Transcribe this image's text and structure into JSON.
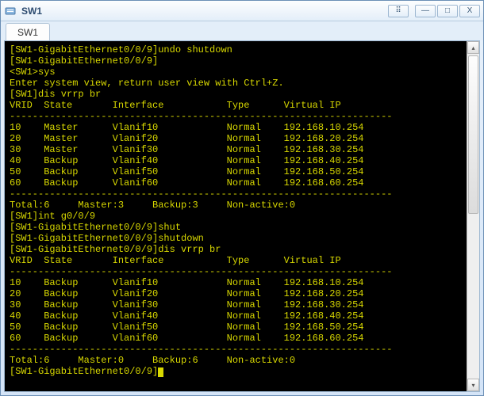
{
  "window": {
    "title": "SW1",
    "tab": "SW1",
    "controls": {
      "pop": "⠿",
      "min": "—",
      "max": "□",
      "close": "X"
    }
  },
  "colors": {
    "term_bg": "#000000",
    "term_fg": "#d8d800"
  },
  "terminal": {
    "lines_pre": [
      "[SW1-GigabitEthernet0/0/9]undo shutdown",
      "[SW1-GigabitEthernet0/0/9]",
      "<SW1>sys",
      "Enter system view, return user view with Ctrl+Z.",
      "[SW1]dis vrrp br"
    ],
    "table1_header": {
      "vrid": "VRID",
      "state": "State",
      "iface": "Interface",
      "type": "Type",
      "vip": "Virtual IP"
    },
    "divider": "-------------------------------------------------------------------",
    "table1": [
      {
        "vrid": "10",
        "state": "Master",
        "iface": "Vlanif10",
        "type": "Normal",
        "vip": "192.168.10.254"
      },
      {
        "vrid": "20",
        "state": "Master",
        "iface": "Vlanif20",
        "type": "Normal",
        "vip": "192.168.20.254"
      },
      {
        "vrid": "30",
        "state": "Master",
        "iface": "Vlanif30",
        "type": "Normal",
        "vip": "192.168.30.254"
      },
      {
        "vrid": "40",
        "state": "Backup",
        "iface": "Vlanif40",
        "type": "Normal",
        "vip": "192.168.40.254"
      },
      {
        "vrid": "50",
        "state": "Backup",
        "iface": "Vlanif50",
        "type": "Normal",
        "vip": "192.168.50.254"
      },
      {
        "vrid": "60",
        "state": "Backup",
        "iface": "Vlanif60",
        "type": "Normal",
        "vip": "192.168.60.254"
      }
    ],
    "summary1": "Total:6     Master:3     Backup:3     Non-active:0",
    "lines_mid": [
      "[SW1]int g0/0/9",
      "[SW1-GigabitEthernet0/0/9]shut",
      "[SW1-GigabitEthernet0/0/9]shutdown",
      "[SW1-GigabitEthernet0/0/9]dis vrrp br"
    ],
    "table2": [
      {
        "vrid": "10",
        "state": "Backup",
        "iface": "Vlanif10",
        "type": "Normal",
        "vip": "192.168.10.254"
      },
      {
        "vrid": "20",
        "state": "Backup",
        "iface": "Vlanif20",
        "type": "Normal",
        "vip": "192.168.20.254"
      },
      {
        "vrid": "30",
        "state": "Backup",
        "iface": "Vlanif30",
        "type": "Normal",
        "vip": "192.168.30.254"
      },
      {
        "vrid": "40",
        "state": "Backup",
        "iface": "Vlanif40",
        "type": "Normal",
        "vip": "192.168.40.254"
      },
      {
        "vrid": "50",
        "state": "Backup",
        "iface": "Vlanif50",
        "type": "Normal",
        "vip": "192.168.50.254"
      },
      {
        "vrid": "60",
        "state": "Backup",
        "iface": "Vlanif60",
        "type": "Normal",
        "vip": "192.168.60.254"
      }
    ],
    "summary2": "Total:6     Master:0     Backup:6     Non-active:0",
    "prompt": "[SW1-GigabitEthernet0/0/9]"
  }
}
